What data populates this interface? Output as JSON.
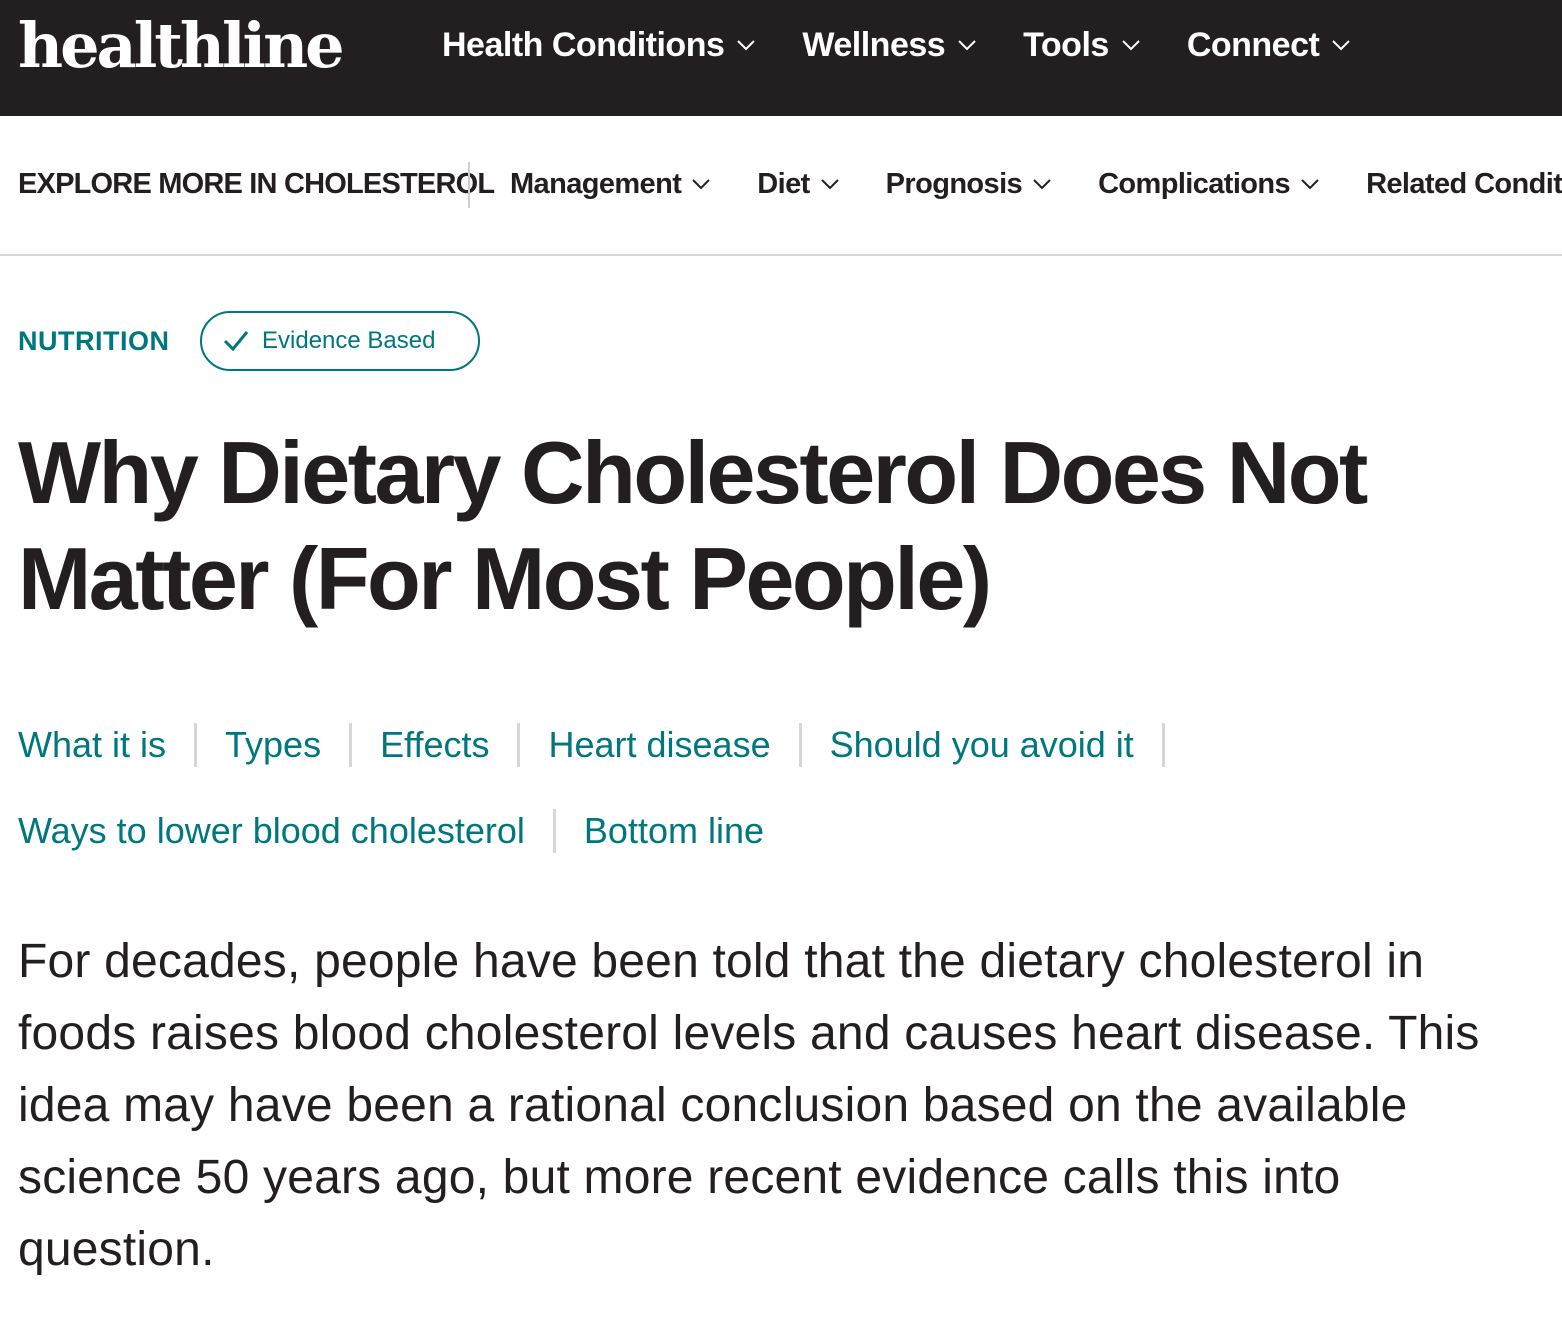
{
  "header": {
    "logo": "healthline",
    "nav": [
      {
        "label": "Health Conditions"
      },
      {
        "label": "Wellness"
      },
      {
        "label": "Tools"
      },
      {
        "label": "Connect"
      }
    ]
  },
  "subnav": {
    "explore_label": "EXPLORE MORE IN CHOLESTEROL",
    "items": [
      {
        "label": "Management"
      },
      {
        "label": "Diet"
      },
      {
        "label": "Prognosis"
      },
      {
        "label": "Complications"
      },
      {
        "label": "Related Conditio"
      }
    ]
  },
  "article": {
    "category": "NUTRITION",
    "badge": "Evidence Based",
    "title": "Why Dietary Cholesterol Does Not Matter (For Most People)",
    "toc": [
      "What it is",
      "Types",
      "Effects",
      "Heart disease",
      "Should you avoid it",
      "Ways to lower blood cholesterol",
      "Bottom line"
    ],
    "intro": "For decades, people have been told that the dietary cholesterol in foods raises blood cholesterol levels and causes heart disease. This idea may have been a rational conclusion based on the available science 50 years ago, but more recent evidence calls this into question."
  },
  "colors": {
    "header_bg": "#231f20",
    "accent": "#00767f",
    "text": "#231f20"
  }
}
